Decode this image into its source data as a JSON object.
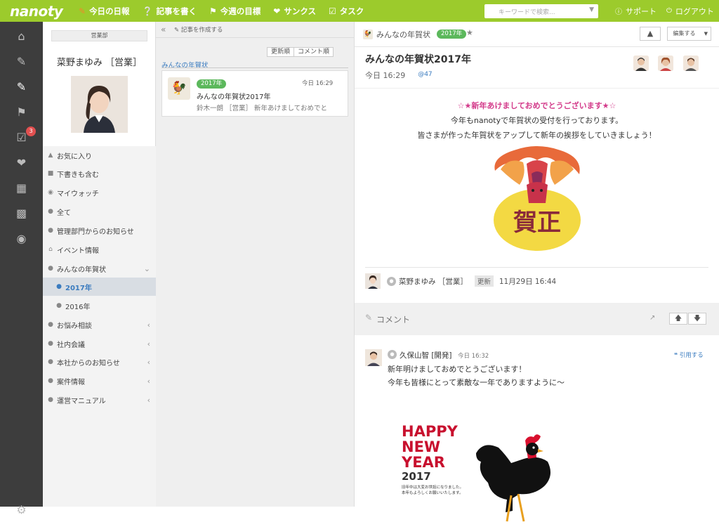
{
  "app": {
    "logo": "nanoty"
  },
  "topnav": [
    {
      "label": "今日の日報",
      "icon": "diary-icon"
    },
    {
      "label": "記事を書く",
      "icon": "write-icon"
    },
    {
      "label": "今週の目標",
      "icon": "flag-icon"
    },
    {
      "label": "サンクス",
      "icon": "heart-icon"
    },
    {
      "label": "タスク",
      "icon": "task-icon"
    }
  ],
  "search": {
    "placeholder": "キーワードで検索..."
  },
  "topright": {
    "support": "サポート",
    "logout": "ログアウト"
  },
  "iconbar": {
    "task_badge": "3"
  },
  "sidebar": {
    "dept": "営業部",
    "user_name": "菜野まゆみ ［営業］",
    "items": [
      {
        "label": "お気に入り"
      },
      {
        "label": "下書きも含む"
      },
      {
        "label": "マイウォッチ"
      },
      {
        "label": "全て"
      },
      {
        "label": "管理部門からのお知らせ"
      },
      {
        "label": "イベント情報"
      },
      {
        "label": "みんなの年賀状"
      },
      {
        "label": "2017年"
      },
      {
        "label": "2016年"
      },
      {
        "label": "お悩み相談"
      },
      {
        "label": "社内会議"
      },
      {
        "label": "本社からのお知らせ"
      },
      {
        "label": "案件情報"
      },
      {
        "label": "運営マニュアル"
      }
    ]
  },
  "middle": {
    "new_post": "記事を作成する",
    "sort_updated": "更新順",
    "sort_comment": "コメント順",
    "breadcrumb": "みんなの年賀状",
    "card": {
      "tag": "2017年",
      "time": "今日 16:29",
      "title": "みんなの年賀状2017年",
      "excerpt": "鈴木一朗 ［営業］ 新年あけましておめでと"
    }
  },
  "post": {
    "category": "みんなの年賀状",
    "tag": "2017年",
    "edit_button": "編集する",
    "title": "みんなの年賀状2017年",
    "time": "今日 16:29",
    "mentions": "@47",
    "line1": "☆★新年あけましておめでとうございます★☆",
    "line2": "今年もnanotyで年賀状の受付を行っております。",
    "line3": "皆さまが作った年賀状をアップして新年の挨拶をしていきましょう！",
    "card_text": "賀正",
    "author": "菜野まゆみ ［営業］",
    "updated_label": "更新",
    "updated_time": "11月29日 16:44"
  },
  "comments": {
    "header": "コメント",
    "items": [
      {
        "author": "久保山智 [開発]",
        "time": "今日 16:32",
        "quote": "引用する",
        "line1": "新年明けましておめでとうございます！",
        "line2": "今年も皆様にとって素敵な一年でありますように〜",
        "card": {
          "happy": "HAPPY",
          "new": "NEW",
          "year": "YEAR",
          "num": "2017",
          "small1": "旧年中は大変お世話になりました。",
          "small2": "本年もよろしくお願いいたします。"
        }
      }
    ]
  },
  "colors": {
    "brand": "#9ccb2c",
    "dark": "#3d3d3d",
    "link": "#3a7bbf",
    "tag": "#5cb85c",
    "pink": "#d33a8a"
  }
}
